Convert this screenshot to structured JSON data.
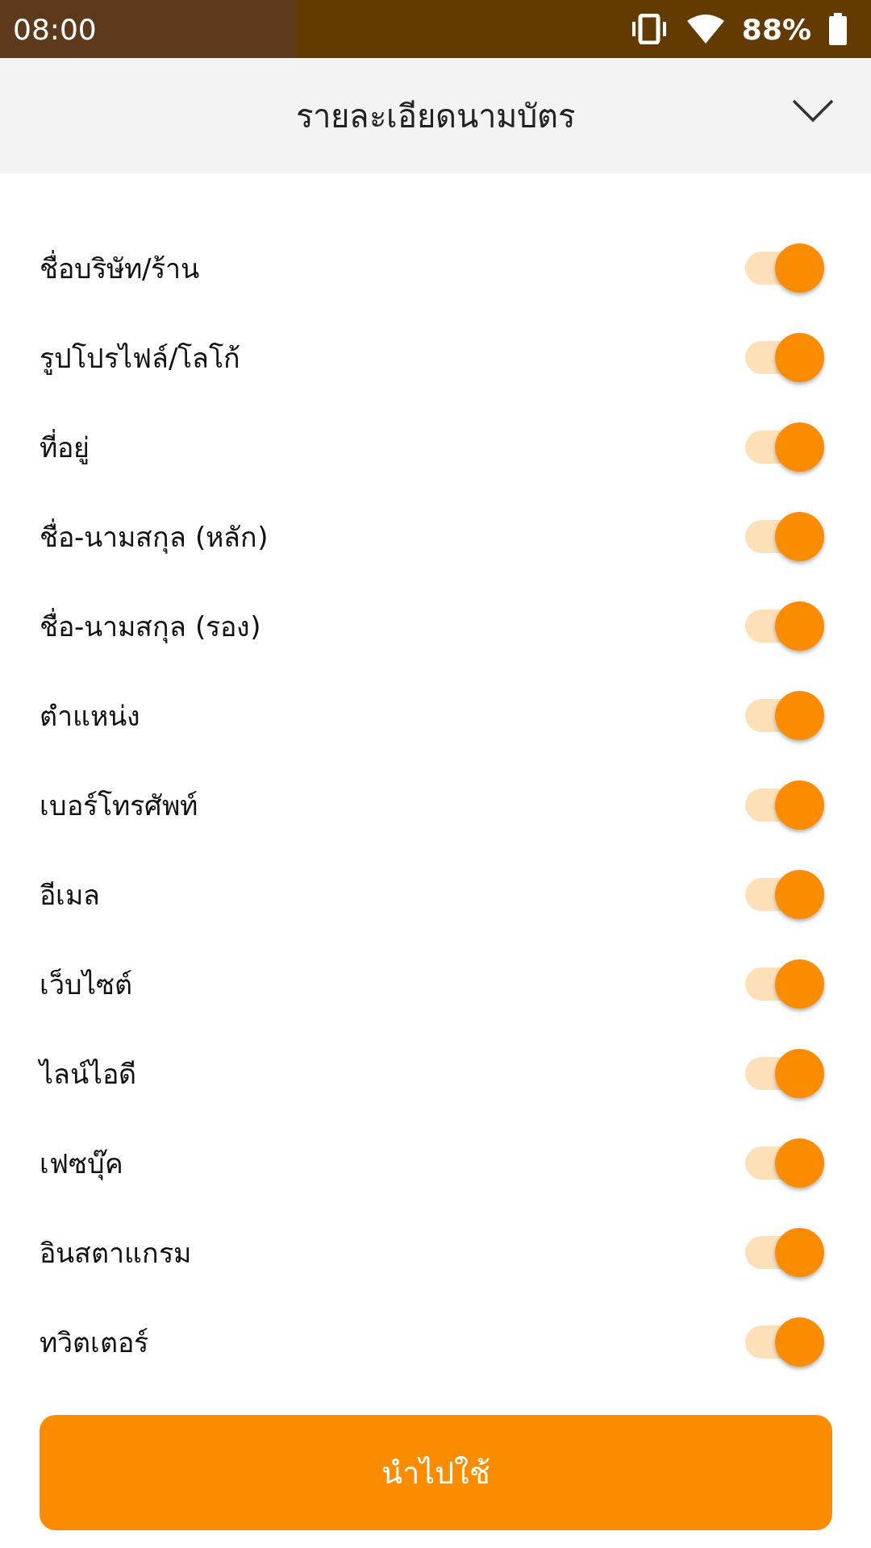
{
  "status_bar": {
    "time": "08:00",
    "battery": "88%"
  },
  "header": {
    "title": "รายละเอียดนามบัตร",
    "expanded": true
  },
  "fields": [
    {
      "label": "ชื่อบริษัท/ร้าน",
      "on": true
    },
    {
      "label": "รูปโปรไฟล์/โลโก้",
      "on": true
    },
    {
      "label": "ที่อยู่",
      "on": true
    },
    {
      "label": "ชื่อ-นามสกุล (หลัก)",
      "on": true
    },
    {
      "label": "ชื่อ-นามสกุล (รอง)",
      "on": true
    },
    {
      "label": "ตำแหน่ง",
      "on": true
    },
    {
      "label": "เบอร์โทรศัพท์",
      "on": true
    },
    {
      "label": "อีเมล",
      "on": true
    },
    {
      "label": "เว็บไซต์",
      "on": true
    },
    {
      "label": "ไลน์ไอดี",
      "on": true
    },
    {
      "label": "เฟซบุ๊ค",
      "on": true
    },
    {
      "label": "อินสตาแกรม",
      "on": true
    },
    {
      "label": "ทวิตเตอร์",
      "on": true
    }
  ],
  "apply_button": {
    "label": "นำไปใช้"
  }
}
